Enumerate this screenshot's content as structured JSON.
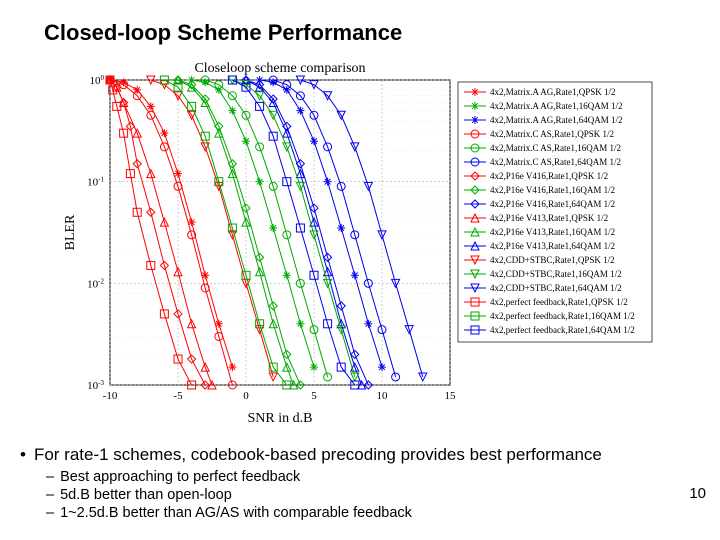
{
  "title": "Closed-loop Scheme Performance",
  "bullet_main": "For rate-1 schemes, codebook-based precoding provides best performance",
  "sub1": "Best approaching to perfect feedback",
  "sub2": "5d.B better than open-loop",
  "sub3": "1~2.5d.B better than AG/AS with comparable feedback",
  "page_number": "10",
  "chart_data": {
    "type": "line",
    "title": "Closeloop scheme comparison",
    "xlabel": "SNR in d.B",
    "ylabel": "BLER",
    "xlim": [
      -10,
      15
    ],
    "ylim": [
      0.001,
      1
    ],
    "xticks": [
      -10,
      -5,
      0,
      5,
      10,
      15
    ],
    "yticks": [
      0.001,
      0.01,
      0.1,
      1
    ],
    "ytick_exponents": [
      -3,
      -2,
      -1,
      0
    ],
    "legend": [
      {
        "name": "4x2,Matrix.A AG,Rate1,QPSK 1/2",
        "color": "#ff0000",
        "marker": "*"
      },
      {
        "name": "4x2,Matrix.A AG,Rate1,16QAM 1/2",
        "color": "#00aa00",
        "marker": "*"
      },
      {
        "name": "4x2,Matrix.A AG,Rate1,64QAM 1/2",
        "color": "#0000ee",
        "marker": "*"
      },
      {
        "name": "4x2,Matrix.C AS,Rate1,QPSK 1/2",
        "color": "#ff0000",
        "marker": "o"
      },
      {
        "name": "4x2,Matrix.C AS,Rate1,16QAM 1/2",
        "color": "#00aa00",
        "marker": "o"
      },
      {
        "name": "4x2,Matrix.C AS,Rate1,64QAM 1/2",
        "color": "#0000ee",
        "marker": "o"
      },
      {
        "name": "4x2,P16e V416,Rate1,QPSK 1/2",
        "color": "#ff0000",
        "marker": "diamond"
      },
      {
        "name": "4x2,P16e V416,Rate1,16QAM 1/2",
        "color": "#00aa00",
        "marker": "diamond"
      },
      {
        "name": "4x2,P16e V416,Rate1,64QAM 1/2",
        "color": "#0000ee",
        "marker": "diamond"
      },
      {
        "name": "4x2,P16e V413,Rate1,QPSK 1/2",
        "color": "#ff0000",
        "marker": "triup"
      },
      {
        "name": "4x2,P16e V413,Rate1,16QAM 1/2",
        "color": "#00aa00",
        "marker": "triup"
      },
      {
        "name": "4x2,P16e V413,Rate1,64QAM 1/2",
        "color": "#0000ee",
        "marker": "triup"
      },
      {
        "name": "4x2,CDD+STBC,Rate1,QPSK 1/2",
        "color": "#ff0000",
        "marker": "tridown"
      },
      {
        "name": "4x2,CDD+STBC,Rate1,16QAM 1/2",
        "color": "#00aa00",
        "marker": "tridown"
      },
      {
        "name": "4x2,CDD+STBC,Rate1,64QAM 1/2",
        "color": "#0000ee",
        "marker": "tridown"
      },
      {
        "name": "4x2,perfect feedback,Rate1,QPSK 1/2",
        "color": "#ff0000",
        "marker": "square"
      },
      {
        "name": "4x2,perfect feedback,Rate1,16QAM 1/2",
        "color": "#00aa00",
        "marker": "square"
      },
      {
        "name": "4x2,perfect feedback,Rate1,64QAM 1/2",
        "color": "#0000ee",
        "marker": "square"
      }
    ],
    "series": [
      {
        "name": "4x2,Matrix.A AG,Rate1,QPSK 1/2",
        "x": [
          -10,
          -9,
          -8,
          -7,
          -6,
          -5,
          -4,
          -3,
          -2,
          -1
        ],
        "y": [
          1,
          0.95,
          0.8,
          0.55,
          0.3,
          0.12,
          0.04,
          0.012,
          0.004,
          0.0015
        ]
      },
      {
        "name": "4x2,Matrix.A AG,Rate1,16QAM 1/2",
        "x": [
          -4,
          -3,
          -2,
          -1,
          0,
          1,
          2,
          3,
          4,
          5
        ],
        "y": [
          1,
          0.95,
          0.8,
          0.5,
          0.25,
          0.1,
          0.035,
          0.012,
          0.004,
          0.0015
        ]
      },
      {
        "name": "4x2,Matrix.A AG,Rate1,64QAM 1/2",
        "x": [
          1,
          2,
          3,
          4,
          5,
          6,
          7,
          8,
          9,
          10
        ],
        "y": [
          1,
          0.95,
          0.8,
          0.5,
          0.25,
          0.1,
          0.035,
          0.012,
          0.004,
          0.0015
        ]
      },
      {
        "name": "4x2,Matrix.C AS,Rate1,QPSK 1/2",
        "x": [
          -10,
          -9,
          -8,
          -7,
          -6,
          -5,
          -4,
          -3,
          -2,
          -1
        ],
        "y": [
          1,
          0.9,
          0.7,
          0.45,
          0.22,
          0.09,
          0.03,
          0.009,
          0.003,
          0.001
        ]
      },
      {
        "name": "4x2,Matrix.C AS,Rate1,16QAM 1/2",
        "x": [
          -3,
          -2,
          -1,
          0,
          1,
          2,
          3,
          4,
          5,
          6
        ],
        "y": [
          1,
          0.9,
          0.7,
          0.45,
          0.22,
          0.09,
          0.03,
          0.01,
          0.0035,
          0.0012
        ]
      },
      {
        "name": "4x2,Matrix.C AS,Rate1,64QAM 1/2",
        "x": [
          2,
          3,
          4,
          5,
          6,
          7,
          8,
          9,
          10,
          11
        ],
        "y": [
          1,
          0.9,
          0.7,
          0.45,
          0.22,
          0.09,
          0.03,
          0.01,
          0.0035,
          0.0012
        ]
      },
      {
        "name": "4x2,P16e V416,Rate1,QPSK 1/2",
        "x": [
          -10,
          -9.5,
          -9,
          -8.5,
          -8,
          -7,
          -6,
          -5,
          -4,
          -3
        ],
        "y": [
          1,
          0.85,
          0.6,
          0.35,
          0.15,
          0.05,
          0.015,
          0.005,
          0.0018,
          0.001
        ]
      },
      {
        "name": "4x2,P16e V416,Rate1,16QAM 1/2",
        "x": [
          -5,
          -4,
          -3,
          -2,
          -1,
          0,
          1,
          2,
          3,
          4
        ],
        "y": [
          1,
          0.9,
          0.65,
          0.35,
          0.15,
          0.055,
          0.018,
          0.006,
          0.002,
          0.001
        ]
      },
      {
        "name": "4x2,P16e V416,Rate1,64QAM 1/2",
        "x": [
          0,
          1,
          2,
          3,
          4,
          5,
          6,
          7,
          8,
          9
        ],
        "y": [
          1,
          0.9,
          0.65,
          0.35,
          0.15,
          0.055,
          0.018,
          0.006,
          0.002,
          0.001
        ]
      },
      {
        "name": "4x2,P16e V413,Rate1,QPSK 1/2",
        "x": [
          -10,
          -9.5,
          -9,
          -8,
          -7,
          -6,
          -5,
          -4,
          -3,
          -2.5
        ],
        "y": [
          1,
          0.85,
          0.6,
          0.3,
          0.12,
          0.04,
          0.013,
          0.004,
          0.0015,
          0.001
        ]
      },
      {
        "name": "4x2,P16e V413,Rate1,16QAM 1/2",
        "x": [
          -5,
          -4,
          -3,
          -2,
          -1,
          0,
          1,
          2,
          3,
          3.5
        ],
        "y": [
          1,
          0.85,
          0.6,
          0.3,
          0.12,
          0.04,
          0.013,
          0.004,
          0.0015,
          0.001
        ]
      },
      {
        "name": "4x2,P16e V413,Rate1,64QAM 1/2",
        "x": [
          0,
          1,
          2,
          3,
          4,
          5,
          6,
          7,
          8,
          8.5
        ],
        "y": [
          1,
          0.85,
          0.6,
          0.3,
          0.12,
          0.04,
          0.013,
          0.004,
          0.0015,
          0.001
        ]
      },
      {
        "name": "4x2,CDD+STBC,Rate1,QPSK 1/2",
        "x": [
          -7,
          -6,
          -5,
          -4,
          -3,
          -2,
          -1,
          0,
          1,
          2
        ],
        "y": [
          1,
          0.9,
          0.7,
          0.45,
          0.22,
          0.09,
          0.03,
          0.01,
          0.0035,
          0.0012
        ]
      },
      {
        "name": "4x2,CDD+STBC,Rate1,16QAM 1/2",
        "x": [
          -1,
          0,
          1,
          2,
          3,
          4,
          5,
          6,
          7,
          8
        ],
        "y": [
          1,
          0.9,
          0.7,
          0.45,
          0.22,
          0.09,
          0.03,
          0.01,
          0.0035,
          0.0012
        ]
      },
      {
        "name": "4x2,CDD+STBC,Rate1,64QAM 1/2",
        "x": [
          4,
          5,
          6,
          7,
          8,
          9,
          10,
          11,
          12,
          13
        ],
        "y": [
          1,
          0.9,
          0.7,
          0.45,
          0.22,
          0.09,
          0.03,
          0.01,
          0.0035,
          0.0012
        ]
      },
      {
        "name": "4x2,perfect feedback,Rate1,QPSK 1/2",
        "x": [
          -10,
          -9.8,
          -9.5,
          -9,
          -8.5,
          -8,
          -7,
          -6,
          -5,
          -4
        ],
        "y": [
          1,
          0.8,
          0.55,
          0.3,
          0.12,
          0.05,
          0.015,
          0.005,
          0.0018,
          0.001
        ]
      },
      {
        "name": "4x2,perfect feedback,Rate1,16QAM 1/2",
        "x": [
          -6,
          -5,
          -4,
          -3,
          -2,
          -1,
          0,
          1,
          2,
          3
        ],
        "y": [
          1,
          0.85,
          0.55,
          0.28,
          0.1,
          0.035,
          0.012,
          0.004,
          0.0015,
          0.001
        ]
      },
      {
        "name": "4x2,perfect feedback,Rate1,64QAM 1/2",
        "x": [
          -1,
          0,
          1,
          2,
          3,
          4,
          5,
          6,
          7,
          8
        ],
        "y": [
          1,
          0.85,
          0.55,
          0.28,
          0.1,
          0.035,
          0.012,
          0.004,
          0.0015,
          0.001
        ]
      }
    ]
  }
}
